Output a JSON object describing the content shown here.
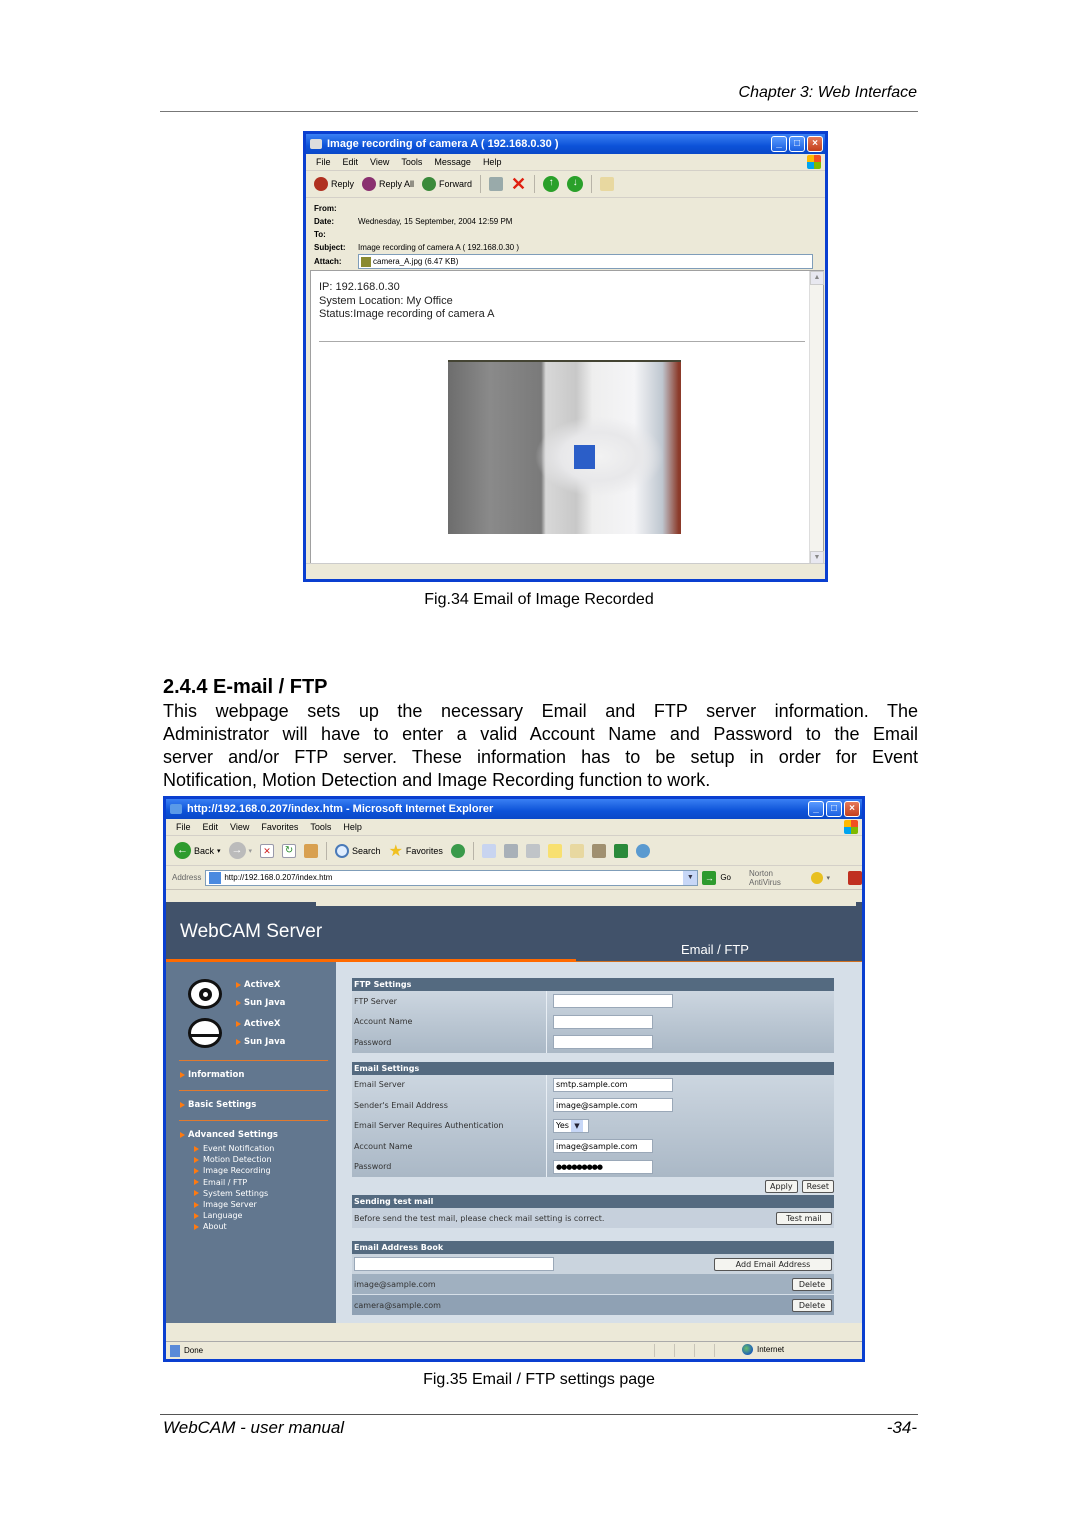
{
  "header": {
    "chapter": "Chapter 3: Web Interface"
  },
  "fig34": {
    "caption": "Fig.34  Email of Image Recorded",
    "window_title": "Image recording of camera A ( 192.168.0.30 )",
    "menu": [
      "File",
      "Edit",
      "View",
      "Tools",
      "Message",
      "Help"
    ],
    "toolbar": {
      "reply": "Reply",
      "reply_all": "Reply All",
      "forward": "Forward"
    },
    "headers": {
      "from_label": "From:",
      "from": "",
      "date_label": "Date:",
      "date": "Wednesday, 15 September, 2004 12:59 PM",
      "to_label": "To:",
      "to": "",
      "subject_label": "Subject:",
      "subject": "Image recording of camera A ( 192.168.0.30 )",
      "attach_label": "Attach:",
      "attach": "camera_A.jpg (6.47 KB)"
    },
    "body": {
      "ip": "IP: 192.168.0.30",
      "location": "System Location: My Office",
      "status": "Status:Image recording of camera A"
    }
  },
  "section": {
    "title": "2.4.4 E-mail / FTP",
    "paragraph_lines": [
      "This webpage sets up the necessary Email and FTP server information.  The",
      "Administrator will have to enter a valid Account Name and Password to the Email",
      "server and/or FTP server.  These information has to be setup in order for Event",
      "Notification, Motion Detection and Image Recording function to work."
    ]
  },
  "fig35": {
    "caption": "Fig.35  Email / FTP settings page",
    "window_title": "http://192.168.0.207/index.htm - Microsoft Internet Explorer",
    "menu": [
      "File",
      "Edit",
      "View",
      "Favorites",
      "Tools",
      "Help"
    ],
    "toolbar": {
      "back": "Back",
      "search": "Search",
      "favorites": "Favorites"
    },
    "address_label": "Address",
    "address": "http://192.168.0.207/index.htm",
    "go": "Go",
    "norton": "Norton AntiVirus",
    "status_text": "Done",
    "zone": "Internet",
    "app": {
      "title": "WebCAM Server",
      "page_name": "Email / FTP",
      "sidebar": {
        "cam1": [
          "ActiveX",
          "Sun Java"
        ],
        "cam2": [
          "ActiveX",
          "Sun Java"
        ],
        "information": "Information",
        "basic": "Basic Settings",
        "advanced": "Advanced Settings",
        "advanced_items": [
          "Event Notification",
          "Motion Detection",
          "Image Recording",
          "Email / FTP",
          "System Settings",
          "Image Server",
          "Language",
          "About"
        ]
      },
      "ftp": {
        "header": "FTP Settings",
        "server_label": "FTP Server",
        "server": "",
        "account_label": "Account Name",
        "account": "",
        "password_label": "Password",
        "password": ""
      },
      "email": {
        "header": "Email Settings",
        "server_label": "Email Server",
        "server": "smtp.sample.com",
        "sender_label": "Sender's Email Address",
        "sender": "image@sample.com",
        "auth_label": "Email Server Requires Authentication",
        "auth": "Yes",
        "account_label": "Account Name",
        "account": "image@sample.com",
        "password_label": "Password",
        "password": "●●●●●●●●●",
        "apply": "Apply",
        "reset": "Reset"
      },
      "test": {
        "header": "Sending test mail",
        "text": "Before send the test mail, please check mail setting is correct.",
        "button": "Test mail"
      },
      "book": {
        "header": "Email Address Book",
        "input": "",
        "add": "Add Email Address",
        "entries": [
          {
            "email": "image@sample.com",
            "delete": "Delete"
          },
          {
            "email": "camera@sample.com",
            "delete": "Delete"
          }
        ]
      }
    }
  },
  "footer": {
    "left": "WebCAM - user manual",
    "page": "-34-"
  }
}
